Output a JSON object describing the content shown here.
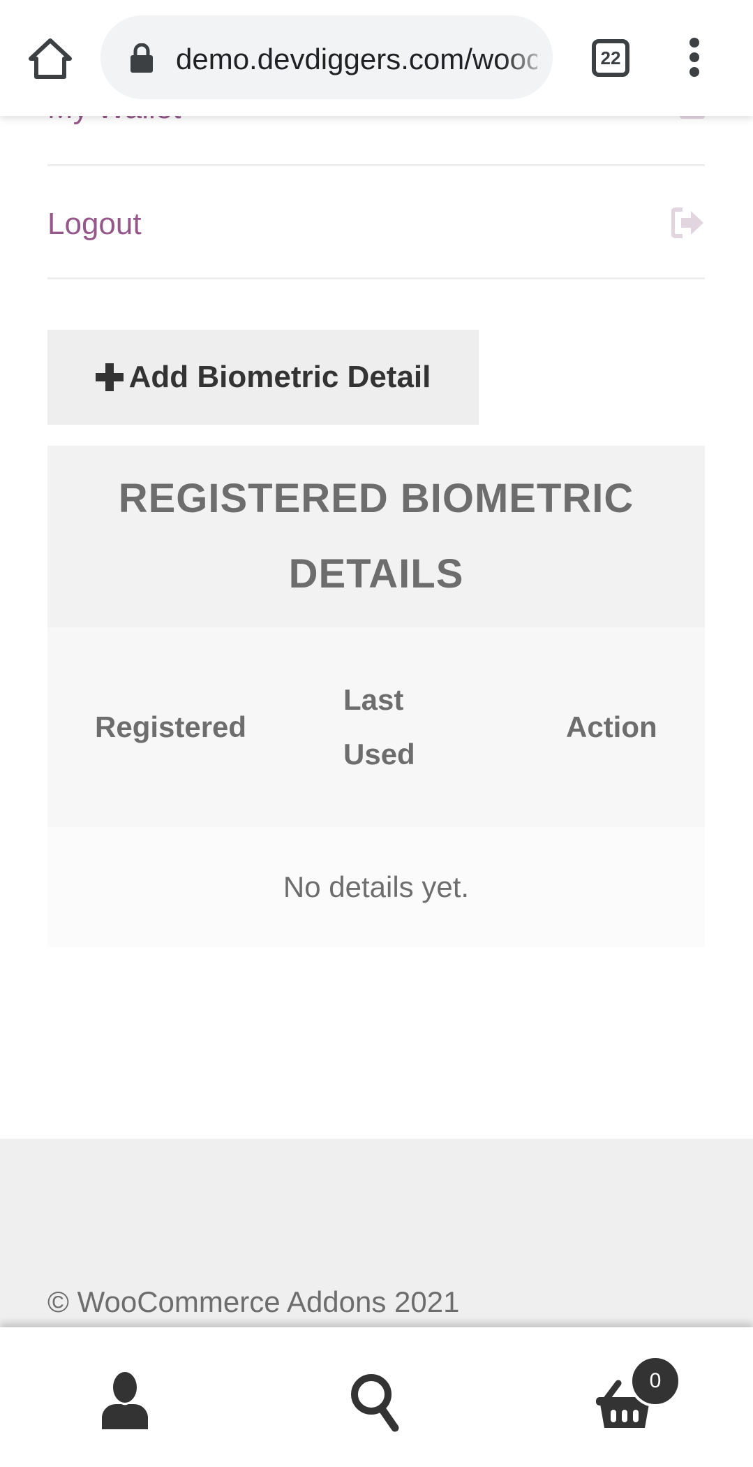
{
  "browser": {
    "url": "demo.devdiggers.com/woocommerce-addons/my-account/biometric-details",
    "tab_count": "22",
    "icons": {
      "home": "home-icon",
      "lock": "lock-icon",
      "tabs": "tab-switcher-icon",
      "menu": "more-vert-icon"
    }
  },
  "account_nav": {
    "items": [
      {
        "label": "My Wallet",
        "icon": "wallet-icon"
      },
      {
        "label": "Logout",
        "icon": "sign-out-icon"
      }
    ]
  },
  "add_button": {
    "label": "Add Biometric Detail",
    "icon": "plus-icon"
  },
  "biometric_table": {
    "title": "REGISTERED BIOMETRIC DETAILS",
    "columns": [
      "Registered",
      "Last Used",
      "Action"
    ],
    "empty_message": "No details yet."
  },
  "footer": {
    "copyright": "© WooCommerce Addons 2021"
  },
  "bottom_nav": {
    "items": [
      {
        "name": "account",
        "icon": "user-icon"
      },
      {
        "name": "search",
        "icon": "search-icon"
      },
      {
        "name": "cart",
        "icon": "basket-icon"
      }
    ],
    "cart_count": "0"
  },
  "colors": {
    "accent": "#96588a",
    "text": "#6d6d6d",
    "dark": "#333333"
  }
}
